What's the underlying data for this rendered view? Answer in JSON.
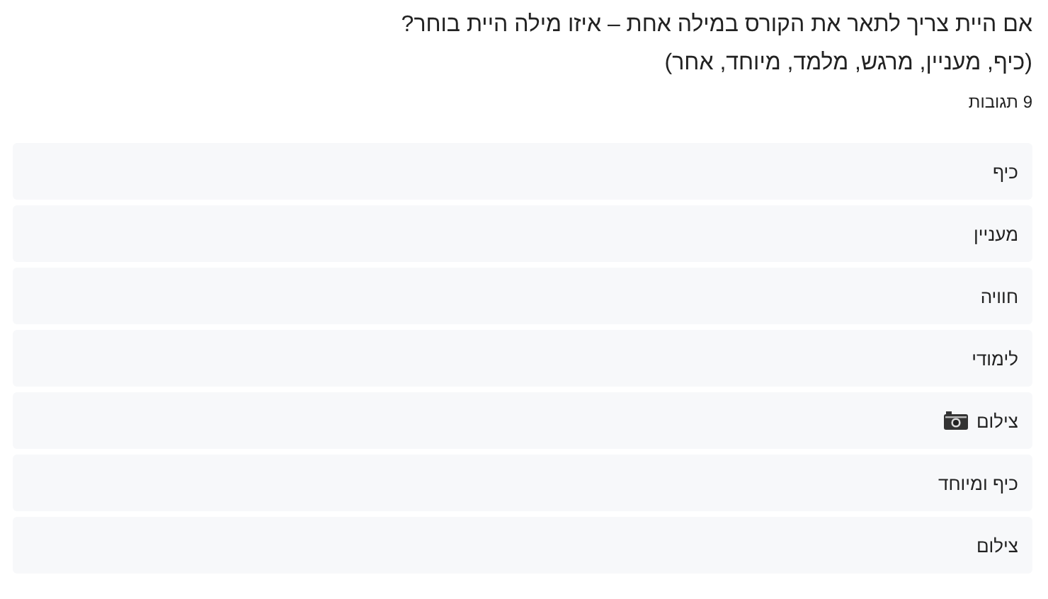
{
  "question": {
    "line_1": "אם היית צריך לתאר את הקורס במילה אחת – איזו מילה היית בוחר?",
    "line_2": "(כיף, מעניין, מרגש, מלמד, מיוחד, אחר)"
  },
  "response_count": "9 תגובות",
  "responses": [
    {
      "text": "כיף",
      "kind": "plain"
    },
    {
      "text": "מעניין",
      "kind": "plain"
    },
    {
      "text": "חוויה",
      "kind": "plain"
    },
    {
      "text": "לימודי",
      "kind": "plain"
    },
    {
      "text": "צילום",
      "kind": "camera"
    },
    {
      "text": "כיף ומיוחד",
      "kind": "plain"
    },
    {
      "text": "צילום",
      "kind": "plain"
    }
  ]
}
